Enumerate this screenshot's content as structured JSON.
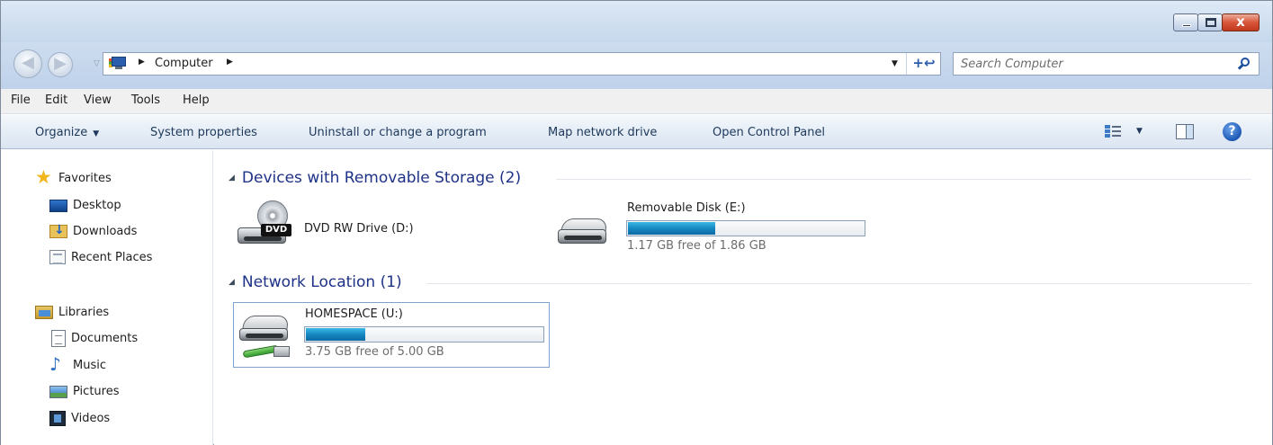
{
  "window": {
    "caption_close": "x"
  },
  "address": {
    "crumb": "Computer",
    "refresh_glyph": "+↩"
  },
  "search": {
    "placeholder": "Search Computer"
  },
  "menu": {
    "file": "File",
    "edit": "Edit",
    "view": "View",
    "tools": "Tools",
    "help": "Help"
  },
  "commands": {
    "organize": "Organize",
    "system_properties": "System properties",
    "uninstall": "Uninstall or change a program",
    "map_network_drive": "Map network drive",
    "open_control_panel": "Open Control Panel",
    "help_glyph": "?"
  },
  "nav": {
    "favorites": "Favorites",
    "desktop": "Desktop",
    "downloads": "Downloads",
    "recent_places": "Recent Places",
    "libraries": "Libraries",
    "documents": "Documents",
    "music": "Music",
    "pictures": "Pictures",
    "videos": "Videos"
  },
  "groups": {
    "removable": {
      "title": "Devices with Removable Storage (2)",
      "dvd": {
        "name": "DVD RW Drive (D:)",
        "badge": "DVD"
      },
      "usb": {
        "name": "Removable Disk (E:)",
        "free_text": "1.17 GB free of 1.86 GB",
        "used_fraction": 0.37
      }
    },
    "network": {
      "title": "Network Location (1)",
      "homespace": {
        "name": "HOMESPACE (U:)",
        "free_text": "3.75 GB free of 5.00 GB",
        "used_fraction": 0.25
      }
    }
  },
  "colors": {
    "group_header": "#1e3287",
    "usage_bar": "#1688c2",
    "close_button": "#c0391d"
  }
}
